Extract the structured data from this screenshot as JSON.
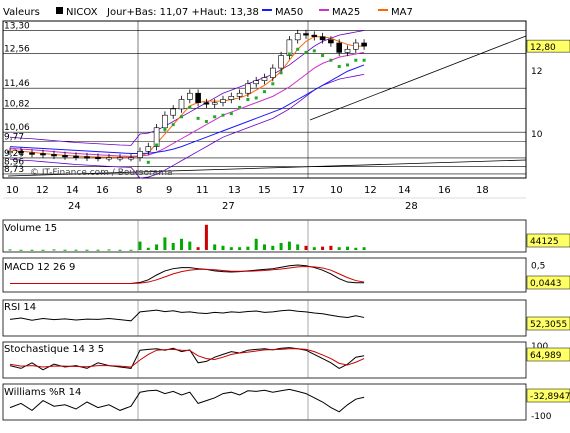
{
  "header": {
    "label": "Valeurs",
    "symbol": "NICOX",
    "range_text": "Jour+Bas: 11,07 +Haut: 13,38",
    "legend": [
      {
        "name": "MA50",
        "color": "#1a1aff"
      },
      {
        "name": "MA25",
        "color": "#cc33cc"
      },
      {
        "name": "MA7",
        "color": "#ff6600"
      }
    ]
  },
  "watermark": "© IT-Finance.com / Boursorama",
  "colors": {
    "candle": "#000000",
    "up": "#00aa00",
    "down": "#cc0000",
    "sar": "#22aa22",
    "bollinger": "#6600cc",
    "badge_bg": "#ffff66"
  },
  "chart_data": [
    {
      "id": "price",
      "type": "line",
      "title": "NICOX",
      "y_ticks": [
        "13,30",
        "12,56",
        "11,46",
        "10,82",
        "10,06",
        "9,77",
        "9,24",
        "8,96",
        "8,73"
      ],
      "y_right_ticks": [
        "12",
        "10"
      ],
      "x_ticks": [
        "10",
        "12",
        "14",
        "16",
        "8",
        "9",
        "11",
        "13",
        "15",
        "17",
        "10",
        "12",
        "14",
        "16",
        "18"
      ],
      "x_groups": [
        "24",
        "27",
        "28"
      ],
      "last_value": "12,80",
      "ylim": [
        8.6,
        13.6
      ],
      "series": [
        {
          "name": "Cours",
          "values": [
            9.45,
            9.4,
            9.38,
            9.35,
            9.32,
            9.3,
            9.28,
            9.26,
            9.25,
            9.25,
            9.25,
            9.25,
            9.45,
            9.6,
            10.2,
            10.6,
            10.8,
            11.1,
            11.3,
            11.0,
            10.95,
            11.0,
            11.1,
            11.2,
            11.3,
            11.6,
            11.7,
            11.8,
            12.1,
            12.5,
            13.0,
            13.2,
            13.15,
            13.1,
            13.0,
            12.9,
            12.6,
            12.7,
            12.9,
            12.8
          ]
        },
        {
          "name": "MA7",
          "values": [
            9.5,
            9.45,
            9.42,
            9.38,
            9.35,
            9.32,
            9.3,
            9.28,
            9.27,
            9.26,
            9.26,
            9.26,
            9.3,
            9.4,
            9.7,
            10.0,
            10.3,
            10.6,
            10.9,
            11.0,
            11.05,
            11.05,
            11.05,
            11.1,
            11.15,
            11.25,
            11.4,
            11.55,
            11.75,
            12.0,
            12.35,
            12.7,
            12.95,
            13.1,
            13.1,
            13.05,
            12.95,
            12.85,
            12.8,
            12.8
          ]
        },
        {
          "name": "MA25",
          "values": [
            9.55,
            9.52,
            9.5,
            9.47,
            9.44,
            9.41,
            9.38,
            9.36,
            9.34,
            9.32,
            9.3,
            9.29,
            9.3,
            9.33,
            9.42,
            9.55,
            9.7,
            9.85,
            10.0,
            10.15,
            10.3,
            10.45,
            10.6,
            10.7,
            10.8,
            10.9,
            11.0,
            11.1,
            11.2,
            11.35,
            11.5,
            11.7,
            11.9,
            12.1,
            12.25,
            12.35,
            12.45,
            12.5,
            12.55,
            12.6
          ]
        },
        {
          "name": "MA50",
          "values": [
            9.6,
            9.58,
            9.56,
            9.54,
            9.52,
            9.5,
            9.48,
            9.46,
            9.44,
            9.42,
            9.4,
            9.38,
            9.38,
            9.39,
            9.42,
            9.46,
            9.52,
            9.6,
            9.7,
            9.8,
            9.9,
            10.0,
            10.1,
            10.2,
            10.3,
            10.4,
            10.5,
            10.6,
            10.7,
            10.8,
            10.95,
            11.1,
            11.25,
            11.4,
            11.55,
            11.7,
            11.85,
            12.0,
            12.1,
            12.2
          ]
        }
      ]
    },
    {
      "id": "volume",
      "type": "bar",
      "title": "Volume 15",
      "last_value": "44125",
      "values": [
        2,
        1,
        1,
        1,
        2,
        1,
        1,
        1,
        1,
        2,
        1,
        1,
        30,
        8,
        20,
        45,
        25,
        40,
        30,
        10,
        90,
        20,
        15,
        10,
        10,
        12,
        40,
        20,
        15,
        25,
        30,
        20,
        15,
        10,
        12,
        15,
        10,
        12,
        8,
        10
      ],
      "down_flags": [
        0,
        0,
        0,
        0,
        0,
        0,
        0,
        0,
        0,
        0,
        0,
        0,
        0,
        0,
        0,
        0,
        0,
        0,
        0,
        1,
        1,
        0,
        0,
        0,
        0,
        0,
        0,
        0,
        0,
        0,
        0,
        0,
        1,
        0,
        1,
        1,
        0,
        0,
        0,
        0
      ]
    },
    {
      "id": "macd",
      "type": "line",
      "title": "MACD 12 26 9",
      "right_ticks": [
        "0,5",
        "0"
      ],
      "last_value": "0,0443",
      "ylim": [
        -0.1,
        0.6
      ],
      "series": [
        {
          "name": "MACD",
          "values": [
            0.02,
            0.02,
            0.02,
            0.02,
            0.02,
            0.02,
            0.02,
            0.02,
            0.02,
            0.02,
            0.02,
            0.02,
            0.05,
            0.12,
            0.25,
            0.36,
            0.42,
            0.45,
            0.45,
            0.42,
            0.4,
            0.36,
            0.34,
            0.33,
            0.34,
            0.36,
            0.38,
            0.4,
            0.42,
            0.46,
            0.5,
            0.52,
            0.5,
            0.45,
            0.38,
            0.28,
            0.15,
            0.06,
            0.04,
            0.04
          ]
        },
        {
          "name": "Signal",
          "values": [
            0.02,
            0.02,
            0.02,
            0.02,
            0.02,
            0.02,
            0.02,
            0.02,
            0.02,
            0.02,
            0.02,
            0.02,
            0.03,
            0.06,
            0.12,
            0.2,
            0.28,
            0.34,
            0.38,
            0.4,
            0.4,
            0.39,
            0.37,
            0.35,
            0.35,
            0.35,
            0.36,
            0.37,
            0.39,
            0.41,
            0.44,
            0.47,
            0.48,
            0.47,
            0.44,
            0.38,
            0.28,
            0.18,
            0.1,
            0.06
          ]
        }
      ]
    },
    {
      "id": "rsi",
      "type": "line",
      "title": "RSI 14",
      "last_value": "52,3055",
      "ylim": [
        0,
        100
      ],
      "series": [
        {
          "name": "RSI",
          "values": [
            45,
            50,
            42,
            48,
            44,
            47,
            43,
            46,
            45,
            48,
            44,
            40,
            72,
            75,
            78,
            73,
            76,
            70,
            72,
            68,
            66,
            70,
            68,
            72,
            70,
            73,
            75,
            70,
            72,
            76,
            78,
            74,
            72,
            68,
            65,
            60,
            55,
            52,
            58,
            52
          ]
        }
      ]
    },
    {
      "id": "stochastic",
      "type": "line",
      "title": "Stochastique 14 3 5",
      "right_ticks": [
        "100"
      ],
      "last_value": "64,989",
      "ylim": [
        0,
        100
      ],
      "series": [
        {
          "name": "%K",
          "values": [
            30,
            20,
            40,
            15,
            35,
            25,
            30,
            20,
            40,
            30,
            25,
            20,
            85,
            88,
            90,
            85,
            92,
            80,
            86,
            40,
            45,
            60,
            70,
            80,
            75,
            85,
            88,
            90,
            86,
            92,
            94,
            90,
            85,
            70,
            55,
            40,
            20,
            35,
            60,
            65
          ]
        },
        {
          "name": "%D",
          "values": [
            35,
            28,
            30,
            25,
            28,
            28,
            27,
            26,
            30,
            30,
            28,
            25,
            50,
            70,
            85,
            87,
            88,
            85,
            84,
            65,
            55,
            52,
            60,
            70,
            75,
            78,
            82,
            86,
            87,
            88,
            90,
            90,
            88,
            80,
            68,
            55,
            38,
            32,
            42,
            55
          ]
        }
      ]
    },
    {
      "id": "williams",
      "type": "line",
      "title": "Williams %R 14",
      "right_ticks": [
        "-100"
      ],
      "last_value": "-32,8947",
      "ylim": [
        -100,
        0
      ],
      "series": [
        {
          "name": "%R",
          "values": [
            -70,
            -55,
            -80,
            -45,
            -65,
            -60,
            -75,
            -50,
            -70,
            -60,
            -80,
            -65,
            -15,
            -10,
            -8,
            -20,
            -12,
            -25,
            -15,
            -55,
            -45,
            -35,
            -20,
            -15,
            -25,
            -10,
            -12,
            -8,
            -15,
            -10,
            -5,
            -12,
            -20,
            -35,
            -50,
            -70,
            -85,
            -60,
            -40,
            -33
          ]
        }
      ]
    }
  ]
}
